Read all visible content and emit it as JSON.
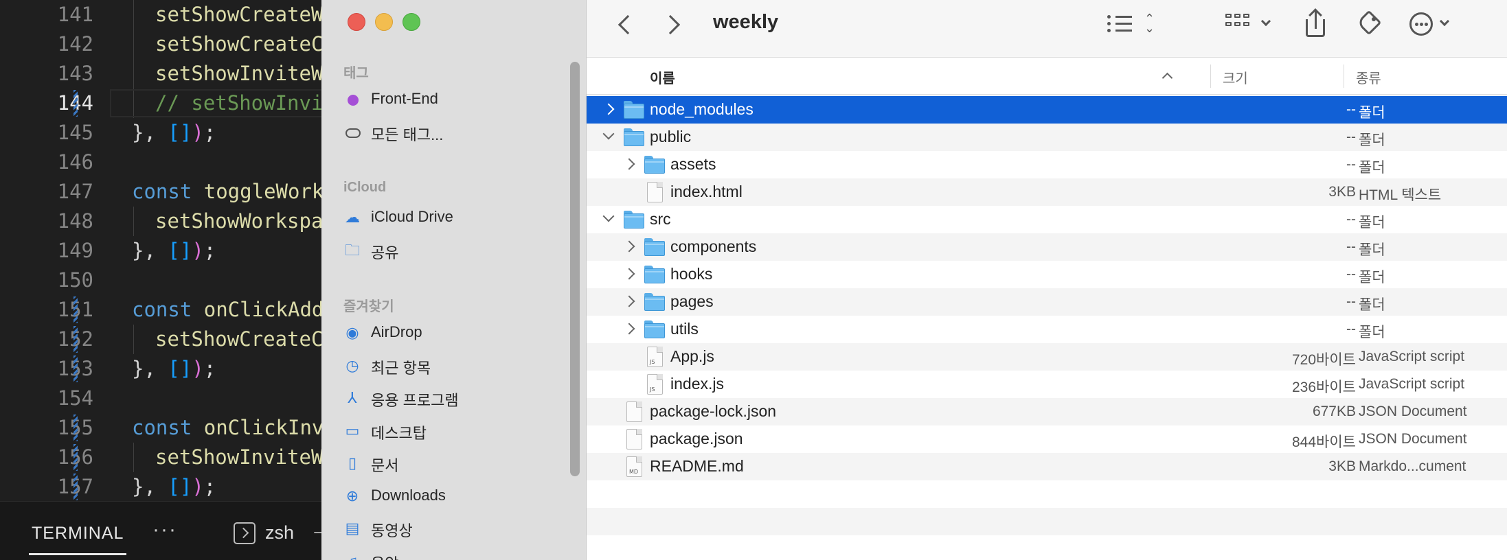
{
  "editor": {
    "lines": [
      {
        "num": "141",
        "indent": 1,
        "tokens": [
          {
            "t": "setShowCreateW",
            "c": "fn"
          }
        ],
        "mark": false
      },
      {
        "num": "142",
        "indent": 1,
        "tokens": [
          {
            "t": "setShowCreateC",
            "c": "fn"
          }
        ],
        "mark": false
      },
      {
        "num": "143",
        "indent": 1,
        "tokens": [
          {
            "t": "setShowInviteW",
            "c": "fn"
          }
        ],
        "mark": false
      },
      {
        "num": "144",
        "indent": 1,
        "tokens": [
          {
            "t": "// setShowInvi",
            "c": "cm"
          }
        ],
        "mark": true,
        "active": true
      },
      {
        "num": "145",
        "indent": 0,
        "tokens": [
          {
            "t": "}",
            "c": "br1"
          },
          {
            "t": ", ",
            "c": "tx"
          },
          {
            "t": "[]",
            "c": "br3"
          },
          {
            "t": ")",
            "c": "br2"
          },
          {
            "t": ";",
            "c": "tx"
          }
        ],
        "mark": false
      },
      {
        "num": "146",
        "indent": 0,
        "tokens": [],
        "mark": false
      },
      {
        "num": "147",
        "indent": 0,
        "tokens": [
          {
            "t": "const ",
            "c": "kw"
          },
          {
            "t": "toggleWork",
            "c": "fn"
          }
        ],
        "mark": false
      },
      {
        "num": "148",
        "indent": 1,
        "tokens": [
          {
            "t": "setShowWorkspa",
            "c": "fn"
          }
        ],
        "mark": false
      },
      {
        "num": "149",
        "indent": 0,
        "tokens": [
          {
            "t": "}",
            "c": "br1"
          },
          {
            "t": ", ",
            "c": "tx"
          },
          {
            "t": "[]",
            "c": "br3"
          },
          {
            "t": ")",
            "c": "br2"
          },
          {
            "t": ";",
            "c": "tx"
          }
        ],
        "mark": false
      },
      {
        "num": "150",
        "indent": 0,
        "tokens": [],
        "mark": false
      },
      {
        "num": "151",
        "indent": 0,
        "tokens": [
          {
            "t": "const ",
            "c": "kw"
          },
          {
            "t": "onClickAdd",
            "c": "fn"
          }
        ],
        "mark": true
      },
      {
        "num": "152",
        "indent": 1,
        "tokens": [
          {
            "t": "setShowCreateC",
            "c": "fn"
          }
        ],
        "mark": true
      },
      {
        "num": "153",
        "indent": 0,
        "tokens": [
          {
            "t": "}",
            "c": "br1"
          },
          {
            "t": ", ",
            "c": "tx"
          },
          {
            "t": "[]",
            "c": "br3"
          },
          {
            "t": ")",
            "c": "br2"
          },
          {
            "t": ";",
            "c": "tx"
          }
        ],
        "mark": true
      },
      {
        "num": "154",
        "indent": 0,
        "tokens": [],
        "mark": false
      },
      {
        "num": "155",
        "indent": 0,
        "tokens": [
          {
            "t": "const ",
            "c": "kw"
          },
          {
            "t": "onClickInv",
            "c": "fn"
          }
        ],
        "mark": true
      },
      {
        "num": "156",
        "indent": 1,
        "tokens": [
          {
            "t": "setShowInviteW",
            "c": "fn"
          }
        ],
        "mark": true
      },
      {
        "num": "157",
        "indent": 0,
        "tokens": [
          {
            "t": "}",
            "c": "br1"
          },
          {
            "t": ", ",
            "c": "tx"
          },
          {
            "t": "[]",
            "c": "br3"
          },
          {
            "t": ")",
            "c": "br2"
          },
          {
            "t": ";",
            "c": "tx"
          }
        ],
        "mark": true
      }
    ],
    "terminal": {
      "tab_label": "TERMINAL",
      "more": "···",
      "shell": "zsh",
      "dash": "−"
    }
  },
  "finder": {
    "title": "weekly",
    "sidebar": {
      "sections": [
        {
          "label": "태그",
          "items": [
            {
              "label": "Front-End",
              "icon": "purple-tag-dot"
            },
            {
              "label": "모든 태그...",
              "icon": "all-tags-icon"
            }
          ]
        },
        {
          "label": "iCloud",
          "items": [
            {
              "label": "iCloud Drive",
              "icon": "cloud-icon"
            },
            {
              "label": "공유",
              "icon": "shared-folder-icon"
            }
          ]
        },
        {
          "label": "즐겨찾기",
          "items": [
            {
              "label": "AirDrop",
              "icon": "airdrop-icon"
            },
            {
              "label": "최근 항목",
              "icon": "clock-icon"
            },
            {
              "label": "응용 프로그램",
              "icon": "applications-icon"
            },
            {
              "label": "데스크탑",
              "icon": "desktop-icon"
            },
            {
              "label": "문서",
              "icon": "document-icon"
            },
            {
              "label": "Downloads",
              "icon": "downloads-icon"
            },
            {
              "label": "동영상",
              "icon": "movies-icon"
            },
            {
              "label": "음악",
              "icon": "music-icon"
            }
          ]
        }
      ]
    },
    "columns": {
      "name": "이름",
      "size": "크기",
      "kind": "종류"
    },
    "rows": [
      {
        "name": "node_modules",
        "level": 0,
        "type": "folder",
        "disclosure": "closed",
        "size": "--",
        "kind": "폴더",
        "selected": true
      },
      {
        "name": "public",
        "level": 0,
        "type": "folder",
        "disclosure": "open",
        "size": "--",
        "kind": "폴더"
      },
      {
        "name": "assets",
        "level": 1,
        "type": "folder",
        "disclosure": "closed",
        "size": "--",
        "kind": "폴더"
      },
      {
        "name": "index.html",
        "level": 1,
        "type": "file",
        "badge": "",
        "size": "3KB",
        "kind": "HTML 텍스트"
      },
      {
        "name": "src",
        "level": 0,
        "type": "folder",
        "disclosure": "open",
        "size": "--",
        "kind": "폴더"
      },
      {
        "name": "components",
        "level": 1,
        "type": "folder",
        "disclosure": "closed",
        "size": "--",
        "kind": "폴더"
      },
      {
        "name": "hooks",
        "level": 1,
        "type": "folder",
        "disclosure": "closed",
        "size": "--",
        "kind": "폴더"
      },
      {
        "name": "pages",
        "level": 1,
        "type": "folder",
        "disclosure": "closed",
        "size": "--",
        "kind": "폴더"
      },
      {
        "name": "utils",
        "level": 1,
        "type": "folder",
        "disclosure": "closed",
        "size": "--",
        "kind": "폴더"
      },
      {
        "name": "App.js",
        "level": 1,
        "type": "file",
        "badge": "JS",
        "size": "720바이트",
        "kind": "JavaScript script"
      },
      {
        "name": "index.js",
        "level": 1,
        "type": "file",
        "badge": "JS",
        "size": "236바이트",
        "kind": "JavaScript script"
      },
      {
        "name": "package-lock.json",
        "level": 0,
        "type": "file",
        "badge": "",
        "size": "677KB",
        "kind": "JSON Document"
      },
      {
        "name": "package.json",
        "level": 0,
        "type": "file",
        "badge": "",
        "size": "844바이트",
        "kind": "JSON Document"
      },
      {
        "name": "README.md",
        "level": 0,
        "type": "file",
        "badge": "MD",
        "size": "3KB",
        "kind": "Markdo...cument"
      }
    ]
  }
}
